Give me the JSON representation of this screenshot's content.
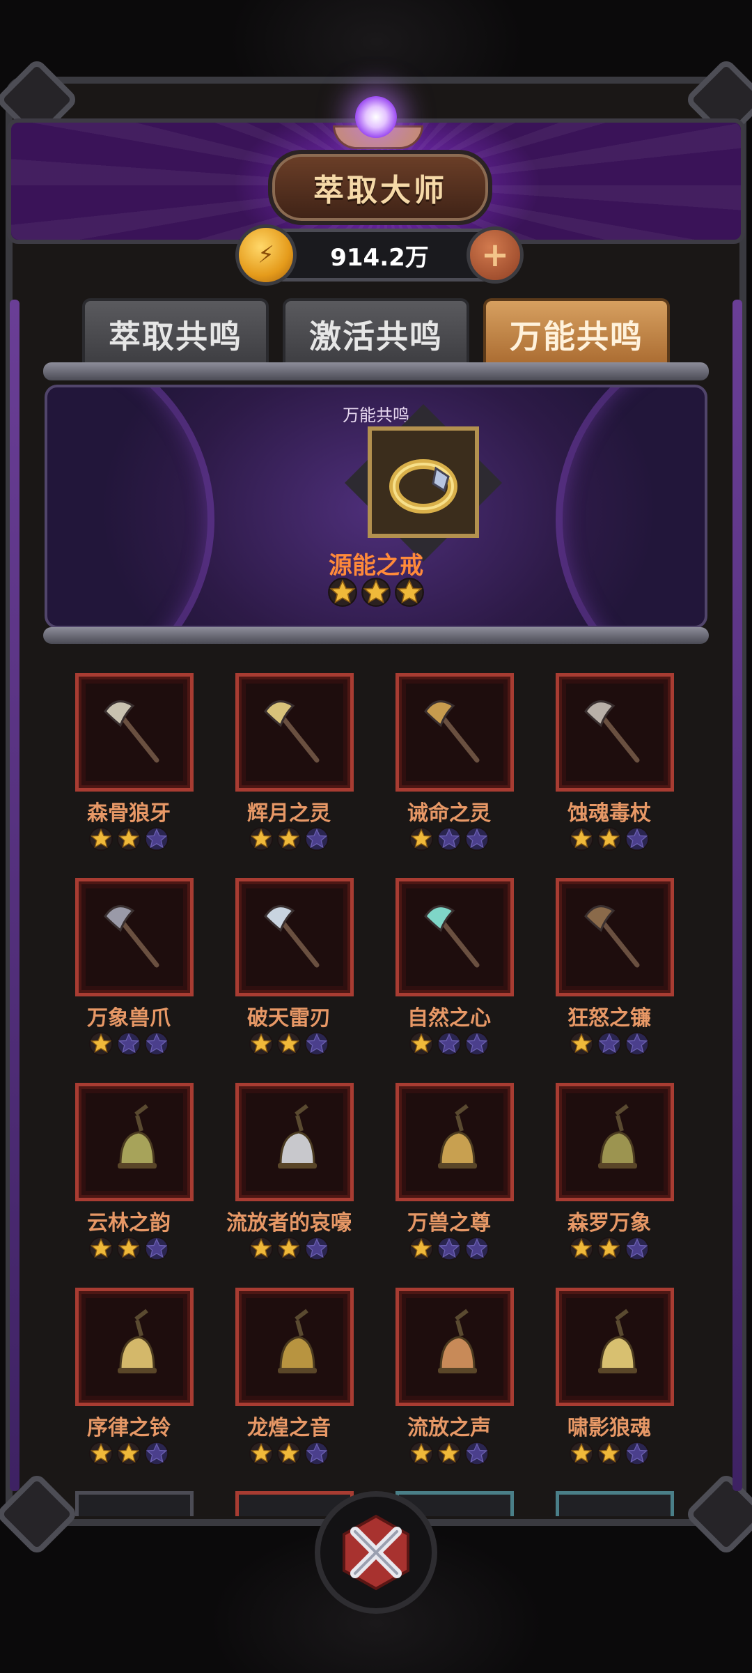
{
  "header": {
    "title": "萃取大师"
  },
  "currency": {
    "amount": "914.2万",
    "coin_icon": "lightning-coin-icon",
    "add_icon": "plus-icon"
  },
  "tabs": [
    {
      "label": "萃取共鸣",
      "active": false
    },
    {
      "label": "激活共鸣",
      "active": false
    },
    {
      "label": "万能共鸣",
      "active": true
    }
  ],
  "featured": {
    "caption": "万能共鸣",
    "name": "源能之戒",
    "stars_filled": 3,
    "stars_total": 3,
    "icon": "ring-icon"
  },
  "items": [
    {
      "name": "森骨狼牙",
      "stars": 2,
      "icon": "bone-axe-icon"
    },
    {
      "name": "辉月之灵",
      "stars": 2,
      "icon": "crescent-staff-icon"
    },
    {
      "name": "诫命之灵",
      "stars": 1,
      "icon": "scepter-icon"
    },
    {
      "name": "蚀魂毒杖",
      "stars": 2,
      "icon": "skull-staff-icon"
    },
    {
      "name": "万象兽爪",
      "stars": 1,
      "icon": "claw-staff-icon"
    },
    {
      "name": "破天雷刃",
      "stars": 2,
      "icon": "lightning-blade-icon"
    },
    {
      "name": "自然之心",
      "stars": 1,
      "icon": "nature-staff-icon"
    },
    {
      "name": "狂怒之镰",
      "stars": 1,
      "icon": "scythe-icon"
    },
    {
      "name": "云林之韵",
      "stars": 2,
      "icon": "moon-bell-icon"
    },
    {
      "name": "流放者的哀嚎",
      "stars": 2,
      "icon": "silver-bell-icon"
    },
    {
      "name": "万兽之尊",
      "stars": 1,
      "icon": "beast-bell-icon"
    },
    {
      "name": "森罗万象",
      "stars": 2,
      "icon": "bronze-bell-icon"
    },
    {
      "name": "序律之铃",
      "stars": 2,
      "icon": "order-bell-icon"
    },
    {
      "name": "龙煌之音",
      "stars": 2,
      "icon": "dragon-bell-icon"
    },
    {
      "name": "流放之声",
      "stars": 2,
      "icon": "exile-bell-icon"
    },
    {
      "name": "啸影狼魂",
      "stars": 2,
      "icon": "wolf-bell-icon"
    }
  ],
  "stars_per_item": 3,
  "colors": {
    "star_filled": "#f0b93a",
    "star_empty": "#2a2550",
    "slot_border": "#a83c32",
    "name_text": "#e79866",
    "featured_name": "#ff8a3a",
    "active_tab": "#c88a4a"
  },
  "close": {
    "icon": "close-x-icon"
  }
}
